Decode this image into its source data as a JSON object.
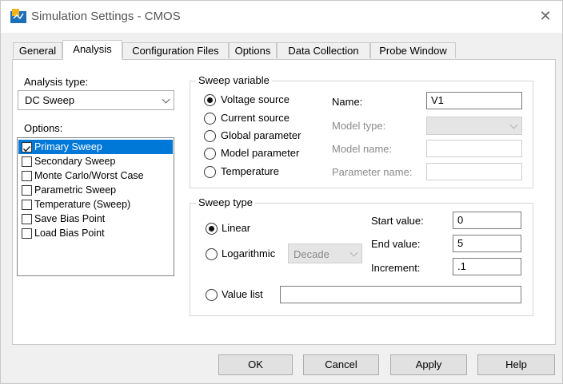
{
  "window": {
    "title": "Simulation Settings - CMOS"
  },
  "tabs": [
    {
      "label": "General"
    },
    {
      "label": "Analysis"
    },
    {
      "label": "Configuration Files"
    },
    {
      "label": "Options"
    },
    {
      "label": "Data Collection"
    },
    {
      "label": "Probe Window"
    }
  ],
  "analysis_type": {
    "label": "Analysis type:",
    "value": "DC Sweep"
  },
  "options": {
    "label": "Options:",
    "items": [
      {
        "label": "Primary Sweep",
        "checked": true,
        "selected": true
      },
      {
        "label": "Secondary Sweep",
        "checked": false
      },
      {
        "label": "Monte Carlo/Worst Case",
        "checked": false
      },
      {
        "label": "Parametric Sweep",
        "checked": false
      },
      {
        "label": "Temperature (Sweep)",
        "checked": false
      },
      {
        "label": "Save Bias Point",
        "checked": false
      },
      {
        "label": "Load Bias Point",
        "checked": false
      }
    ]
  },
  "sweep_variable": {
    "title": "Sweep variable",
    "radios": [
      {
        "label": "Voltage source",
        "selected": true
      },
      {
        "label": "Current source",
        "selected": false
      },
      {
        "label": "Global parameter",
        "selected": false
      },
      {
        "label": "Model parameter",
        "selected": false
      },
      {
        "label": "Temperature",
        "selected": false
      }
    ],
    "name_label": "Name:",
    "name_value": "V1",
    "model_type_label": "Model type:",
    "model_type_value": "",
    "model_name_label": "Model name:",
    "model_name_value": "",
    "parameter_name_label": "Parameter name:",
    "parameter_name_value": ""
  },
  "sweep_type": {
    "title": "Sweep type",
    "linear_label": "Linear",
    "linear_selected": true,
    "log_label": "Logarithmic",
    "log_selected": false,
    "log_scale_value": "Decade",
    "value_list_label": "Value list",
    "value_list_selected": false,
    "value_list_value": "",
    "start_label": "Start value:",
    "start_value": "0",
    "end_label": "End value:",
    "end_value": "5",
    "increment_label": "Increment:",
    "increment_value": ".1"
  },
  "buttons": {
    "ok": "OK",
    "cancel": "Cancel",
    "apply": "Apply",
    "help": "Help"
  }
}
